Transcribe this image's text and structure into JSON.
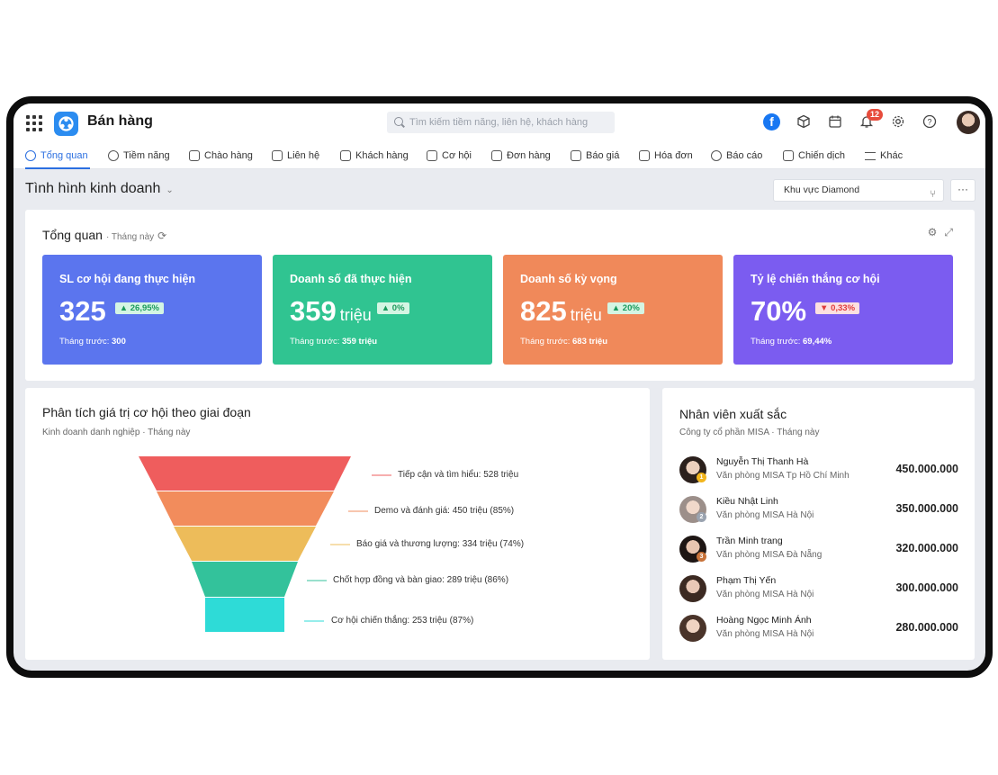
{
  "app": {
    "title": "Bán hàng",
    "logo": "misa-logo"
  },
  "search": {
    "placeholder": "Tìm kiếm tiềm năng, liên hệ, khách hàng"
  },
  "toolbar": {
    "notification_count": "12",
    "icons": [
      "facebook-icon",
      "package-icon",
      "calendar-icon",
      "bell-icon",
      "gear-icon",
      "help-icon"
    ]
  },
  "nav": {
    "items": [
      {
        "label": "Tổng quan",
        "icon": "home-icon"
      },
      {
        "label": "Tiềm năng",
        "icon": "user-icon"
      },
      {
        "label": "Chào hàng",
        "icon": "magnet-icon"
      },
      {
        "label": "Liên hệ",
        "icon": "contact-icon"
      },
      {
        "label": "Khách hàng",
        "icon": "building-icon"
      },
      {
        "label": "Cơ hội",
        "icon": "wallet-icon"
      },
      {
        "label": "Đơn hàng",
        "icon": "cart-icon"
      },
      {
        "label": "Báo giá",
        "icon": "quote-icon"
      },
      {
        "label": "Hóa đơn",
        "icon": "invoice-icon"
      },
      {
        "label": "Báo cáo",
        "icon": "pie-icon"
      },
      {
        "label": "Chiến dịch",
        "icon": "megaphone-icon"
      },
      {
        "label": "Khác",
        "icon": "menu-icon"
      }
    ]
  },
  "page": {
    "title": "Tình hình kinh doanh",
    "region": "Khu vực Diamond",
    "more": "···"
  },
  "overview": {
    "title": "Tổng quan",
    "period": "· Tháng này",
    "kpis": [
      {
        "label": "SL cơ hội đang thực hiện",
        "value": "325",
        "unit": "",
        "change": "▲ 26,95%",
        "prev_label": "Tháng trước:",
        "prev_value": "300",
        "color": "#5b75ee"
      },
      {
        "label": "Doanh số đã thực hiện",
        "value": "359",
        "unit": "triệu",
        "change": "▲ 0%",
        "prev_label": "Tháng trước:",
        "prev_value": "359 triệu",
        "color": "#30c491"
      },
      {
        "label": "Doanh số kỳ vọng",
        "value": "825",
        "unit": "triệu",
        "change": "▲ 20%",
        "prev_label": "Tháng trước:",
        "prev_value": "683 triệu",
        "color": "#f0895a"
      },
      {
        "label": "Tỷ lệ chiến thắng cơ hội",
        "value": "70%",
        "unit": "",
        "change": "▼ 0,33%",
        "prev_label": "Tháng trước:",
        "prev_value": "69,44%",
        "color": "#7b5cf0"
      }
    ]
  },
  "funnel": {
    "title": "Phân tích giá trị cơ hội theo giai đoạn",
    "subtitle": "Kinh doanh danh nghiệp  ·  Tháng này",
    "stages": [
      {
        "label": "Tiếp cận và tìm hiểu:",
        "value": "528 triệu",
        "color": "#ef5d5d"
      },
      {
        "label": "Demo và đánh giá:",
        "value": "450 triệu (85%)",
        "color": "#f28c5c"
      },
      {
        "label": "Báo giá và thương lượng:",
        "value": "334 triệu (74%)",
        "color": "#edbc5a"
      },
      {
        "label": "Chốt hợp đồng và bàn giao:",
        "value": "289 triệu (86%)",
        "color": "#33c29b"
      },
      {
        "label": "Cơ hội chiến thắng:",
        "value": "253 triệu (87%)",
        "color": "#2edbd7"
      }
    ]
  },
  "employees": {
    "title": "Nhân viên xuất sắc",
    "subtitle": "Công ty cổ phần MISA  ·  Tháng này",
    "list": [
      {
        "name": "Nguyễn Thị Thanh Hà",
        "office": "Văn phòng MISA Tp Hồ Chí Minh",
        "value": "450.000.000",
        "rank": "1"
      },
      {
        "name": "Kiều Nhật Linh",
        "office": "Văn phòng MISA Hà Nội",
        "value": "350.000.000",
        "rank": "2"
      },
      {
        "name": "Trần Minh trang",
        "office": "Văn phòng MISA Đà Nẵng",
        "value": "320.000.000",
        "rank": "3"
      },
      {
        "name": "Phạm Thị Yến",
        "office": "Văn phòng MISA Hà Nội",
        "value": "300.000.000",
        "rank": ""
      },
      {
        "name": "Hoàng Ngọc Minh Ánh",
        "office": "Văn phòng MISA Hà Nội",
        "value": "280.000.000",
        "rank": ""
      }
    ]
  }
}
